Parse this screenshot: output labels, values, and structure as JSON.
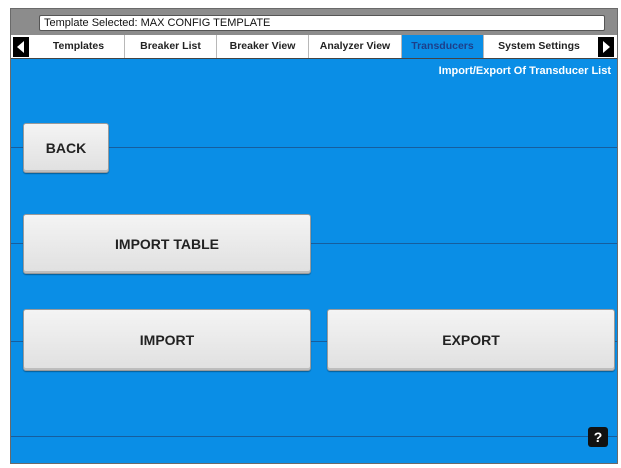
{
  "header": {
    "template_label": "Template Selected: MAX CONFIG TEMPLATE"
  },
  "tabs": [
    {
      "label": "Templates"
    },
    {
      "label": "Breaker List"
    },
    {
      "label": "Breaker View"
    },
    {
      "label": "Analyzer View"
    },
    {
      "label": "Transducers"
    },
    {
      "label": "System Settings"
    }
  ],
  "active_tab": "Transducers",
  "page": {
    "subtitle": "Import/Export Of Transducer List"
  },
  "buttons": {
    "back": "BACK",
    "import_table": "IMPORT TABLE",
    "import": "IMPORT",
    "export": "EXPORT",
    "help": "?"
  },
  "colors": {
    "background": "#0a8ee6",
    "button_face": "#ececec",
    "active_tab": "#0a8ee6"
  },
  "icons": {
    "tab_scroll_left": "left-arrow-icon",
    "tab_scroll_right": "right-arrow-icon",
    "help": "help-icon"
  }
}
